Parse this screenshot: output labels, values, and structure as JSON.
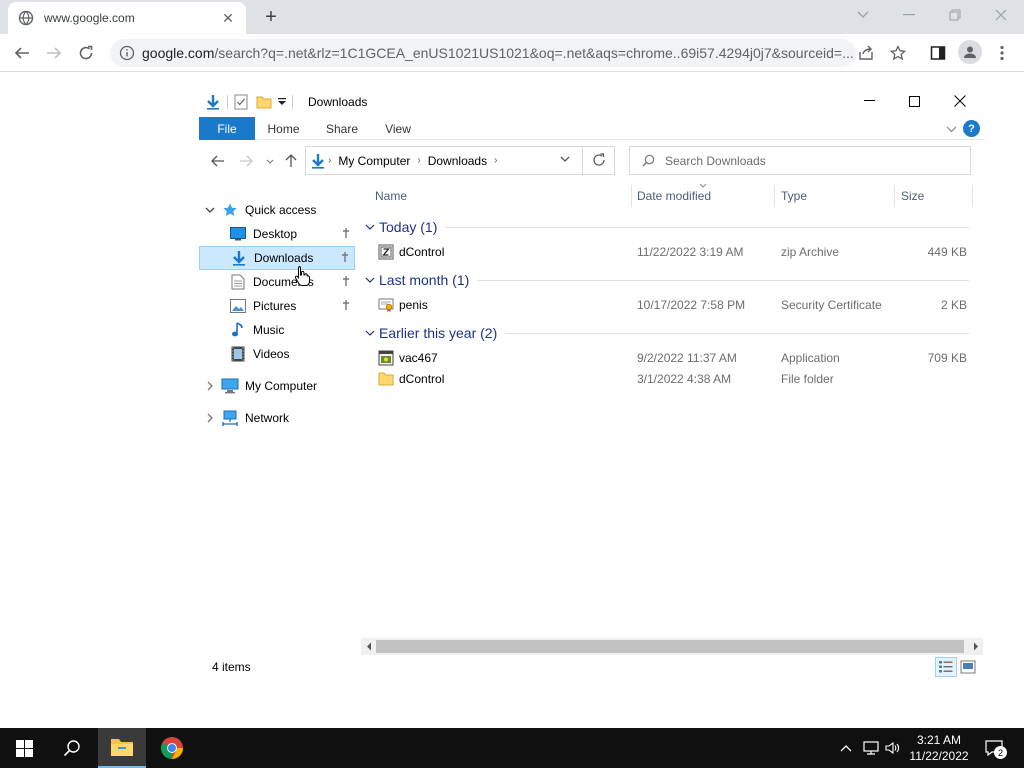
{
  "browser": {
    "tab_title": "www.google.com",
    "url_host": "google.com",
    "url_rest": "/search?q=.net&rlz=1C1GCEA_enUS1021US1021&oq=.net&aqs=chrome..69i57.4294j0j7&sourceid=..."
  },
  "explorer": {
    "title": "Downloads",
    "ribbon_tabs": [
      "File",
      "Home",
      "Share",
      "View"
    ],
    "breadcrumb": [
      "My Computer",
      "Downloads"
    ],
    "search_placeholder": "Search Downloads",
    "nav": {
      "quick_access": "Quick access",
      "items": [
        {
          "label": "Desktop",
          "icon": "desktop-icon",
          "pinned": true
        },
        {
          "label": "Downloads",
          "icon": "downloads-icon",
          "pinned": true,
          "selected": true
        },
        {
          "label": "Documents",
          "icon": "documents-icon",
          "pinned": true
        },
        {
          "label": "Pictures",
          "icon": "pictures-icon",
          "pinned": true
        },
        {
          "label": "Music",
          "icon": "music-icon",
          "pinned": false
        },
        {
          "label": "Videos",
          "icon": "videos-icon",
          "pinned": false
        }
      ],
      "my_computer": "My Computer",
      "network": "Network"
    },
    "columns": {
      "name": "Name",
      "date": "Date modified",
      "type": "Type",
      "size": "Size"
    },
    "groups": [
      {
        "label": "Today (1)",
        "rows": [
          {
            "name": "dControl",
            "date": "11/22/2022 3:19 AM",
            "type": "zip Archive",
            "size": "449 KB",
            "icon": "zip-icon"
          }
        ]
      },
      {
        "label": "Last month (1)",
        "rows": [
          {
            "name": "penis",
            "date": "10/17/2022 7:58 PM",
            "type": "Security Certificate",
            "size": "2 KB",
            "icon": "certificate-icon"
          }
        ]
      },
      {
        "label": "Earlier this year (2)",
        "rows": [
          {
            "name": "vac467",
            "date": "9/2/2022 11:37 AM",
            "type": "Application",
            "size": "709 KB",
            "icon": "application-icon"
          },
          {
            "name": "dControl",
            "date": "3/1/2022 4:38 AM",
            "type": "File folder",
            "size": "",
            "icon": "folder-icon"
          }
        ]
      }
    ],
    "status_count": "4 items"
  },
  "taskbar": {
    "time": "3:21 AM",
    "date": "11/22/2022",
    "notification_count": "2"
  },
  "colors": {
    "accent": "#1979ca",
    "group_header": "#1e3287",
    "selected_bg": "#cce8ff",
    "taskbar": "#101010"
  }
}
